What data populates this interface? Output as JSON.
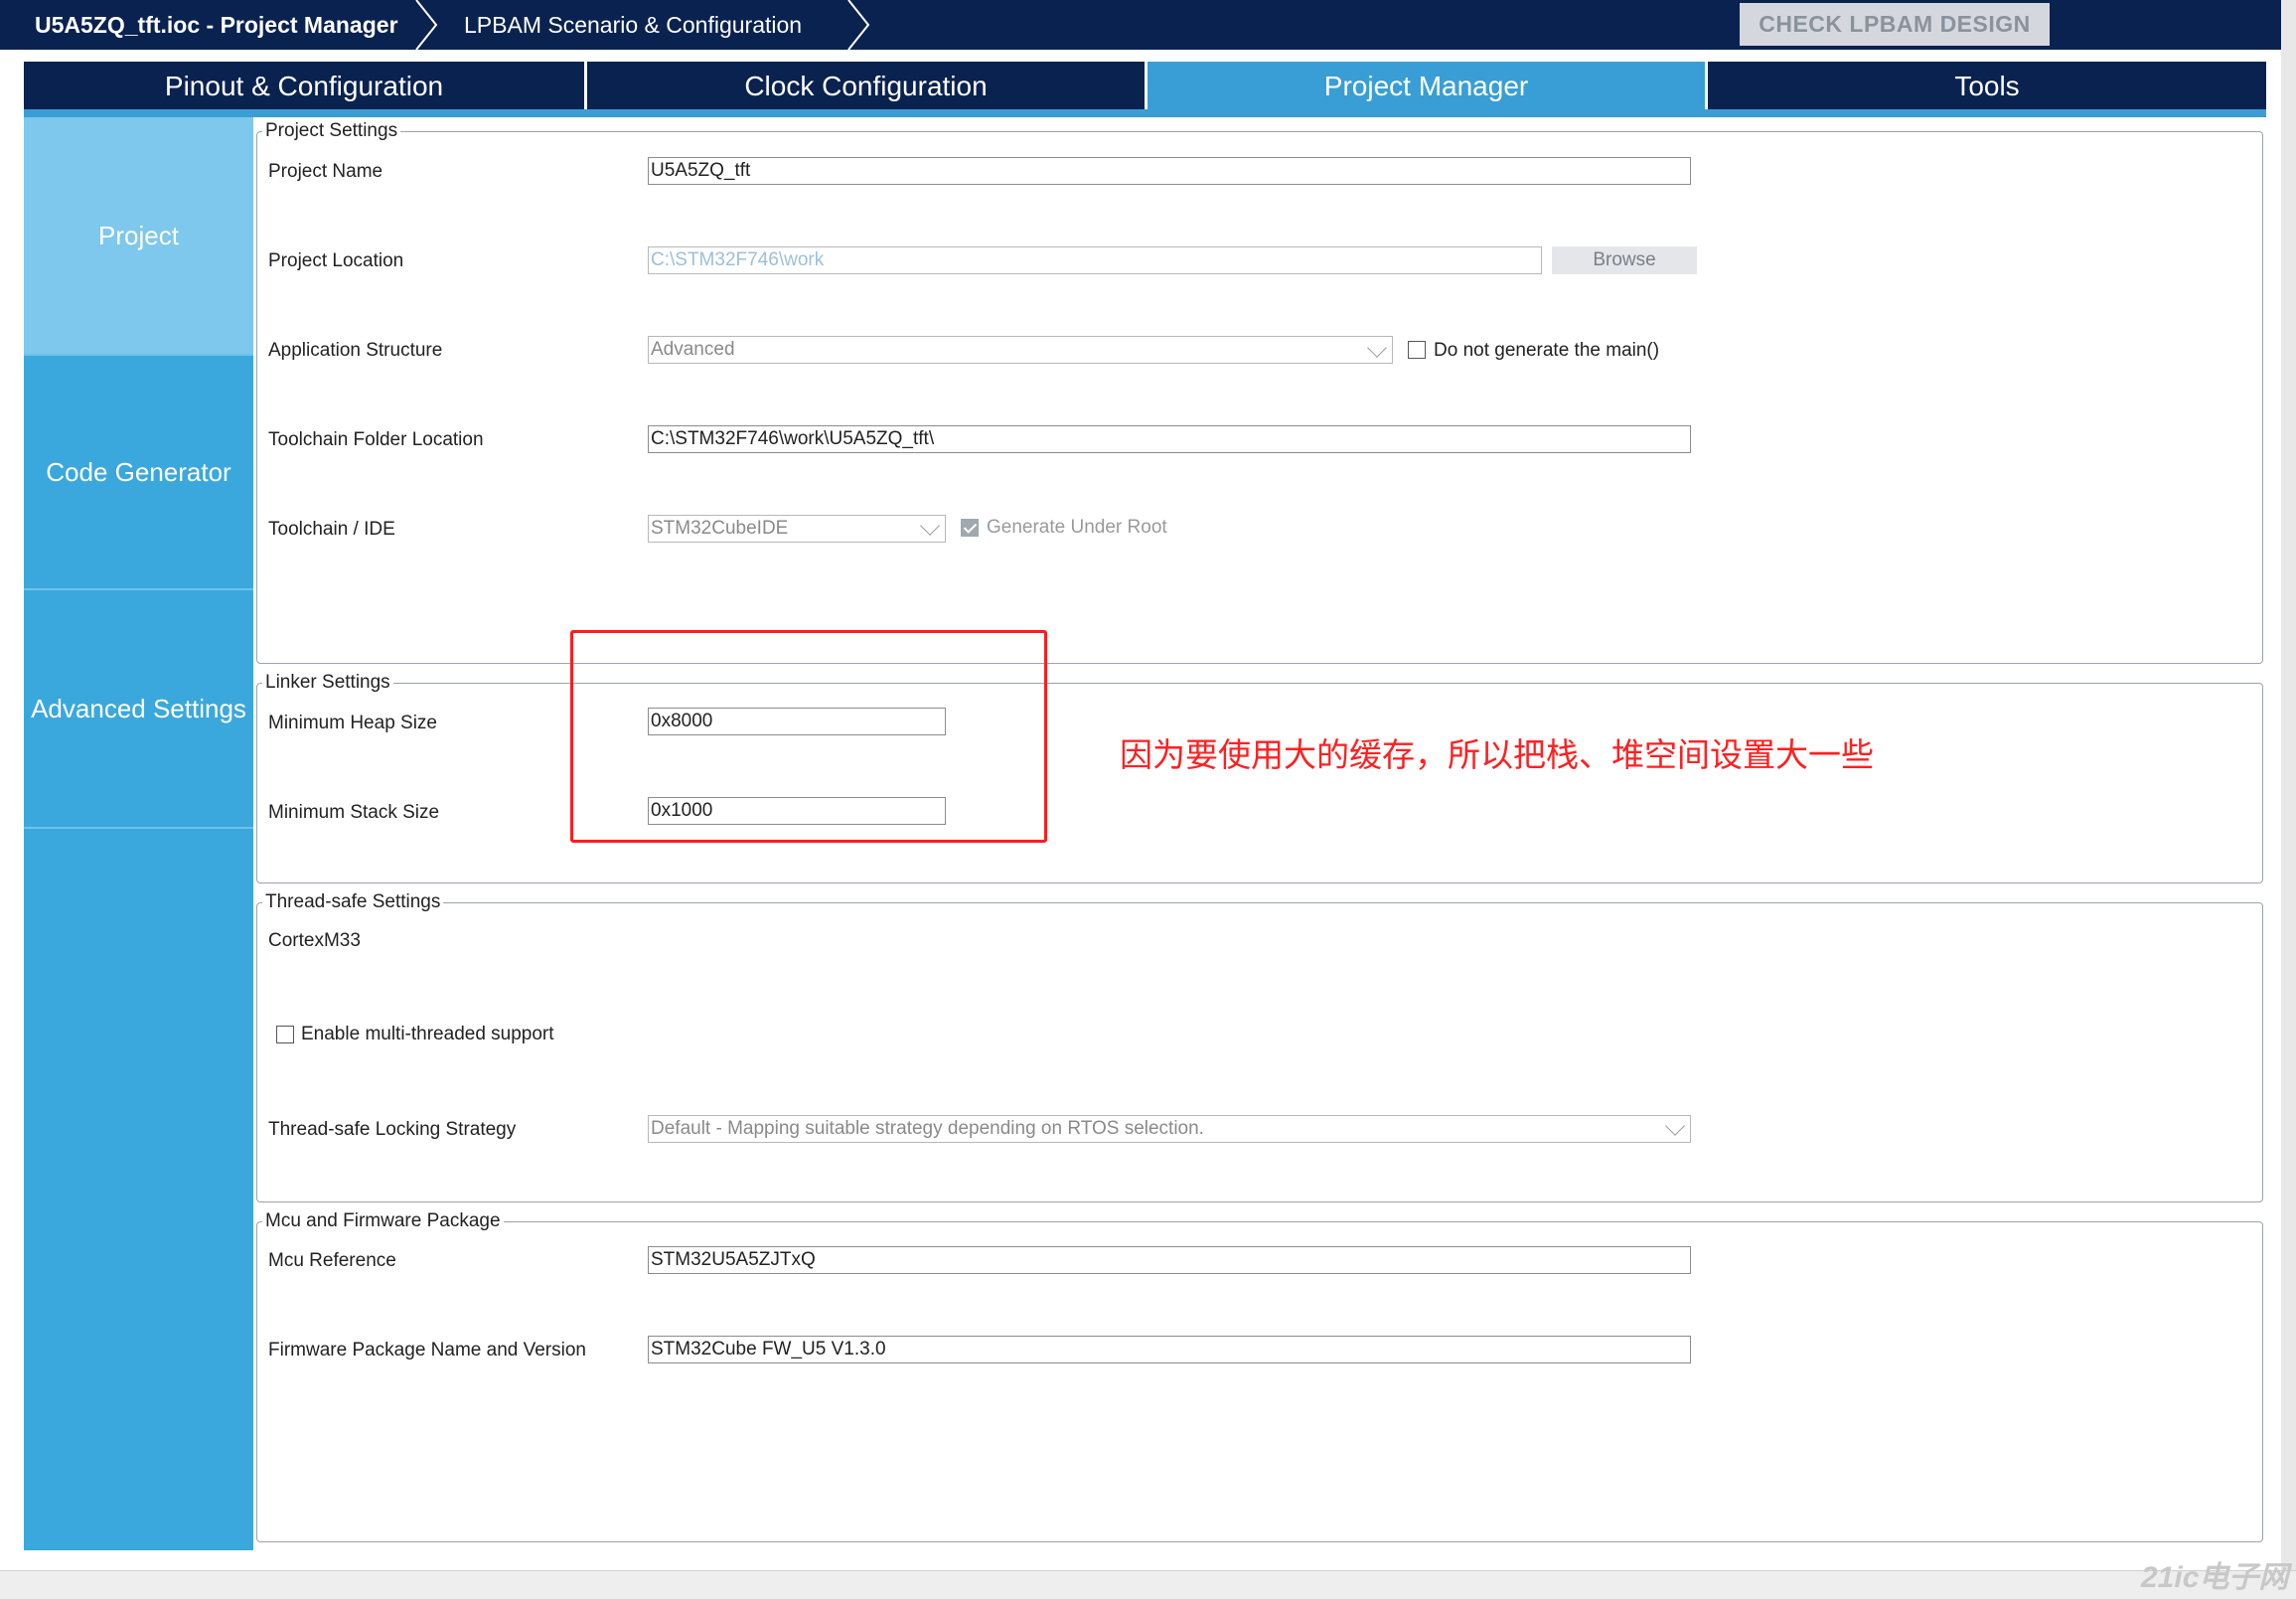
{
  "breadcrumb": {
    "file": "U5A5ZQ_tft.ioc - Project Manager",
    "scenario": "LPBAM Scenario & Configuration",
    "check_button": "CHECK LPBAM DESIGN"
  },
  "tabs": [
    {
      "label": "Pinout & Configuration"
    },
    {
      "label": "Clock Configuration"
    },
    {
      "label": "Project Manager"
    },
    {
      "label": "Tools"
    }
  ],
  "sidebar": [
    {
      "label": "Project"
    },
    {
      "label": "Code Generator"
    },
    {
      "label": "Advanced Settings"
    }
  ],
  "project_settings": {
    "title": "Project Settings",
    "project_name_label": "Project Name",
    "project_name": "U5A5ZQ_tft",
    "project_location_label": "Project Location",
    "project_location": "C:\\STM32F746\\work",
    "browse": "Browse",
    "app_structure_label": "Application Structure",
    "app_structure": "Advanced",
    "no_main_label": "Do not generate the main()",
    "toolchain_folder_label": "Toolchain Folder Location",
    "toolchain_folder": "C:\\STM32F746\\work\\U5A5ZQ_tft\\",
    "toolchain_ide_label": "Toolchain / IDE",
    "toolchain_ide": "STM32CubeIDE",
    "generate_under_root_label": "Generate Under Root"
  },
  "linker_settings": {
    "title": "Linker Settings",
    "heap_label": "Minimum Heap Size",
    "heap": "0x8000",
    "stack_label": "Minimum Stack Size",
    "stack": "0x1000"
  },
  "annotation": "因为要使用大的缓存，所以把栈、堆空间设置大一些",
  "thread_safe": {
    "title": "Thread-safe Settings",
    "core": "CortexM33",
    "multithread_label": "Enable multi-threaded support",
    "strategy_label": "Thread-safe Locking Strategy",
    "strategy": "Default  -  Mapping suitable strategy depending on RTOS selection."
  },
  "mcu_package": {
    "title": "Mcu and Firmware Package",
    "mcu_ref_label": "Mcu Reference",
    "mcu_ref": "STM32U5A5ZJTxQ",
    "firmware_label": "Firmware Package Name and Version",
    "firmware": "STM32Cube FW_U5 V1.3.0"
  },
  "watermark": "21ic电子网"
}
